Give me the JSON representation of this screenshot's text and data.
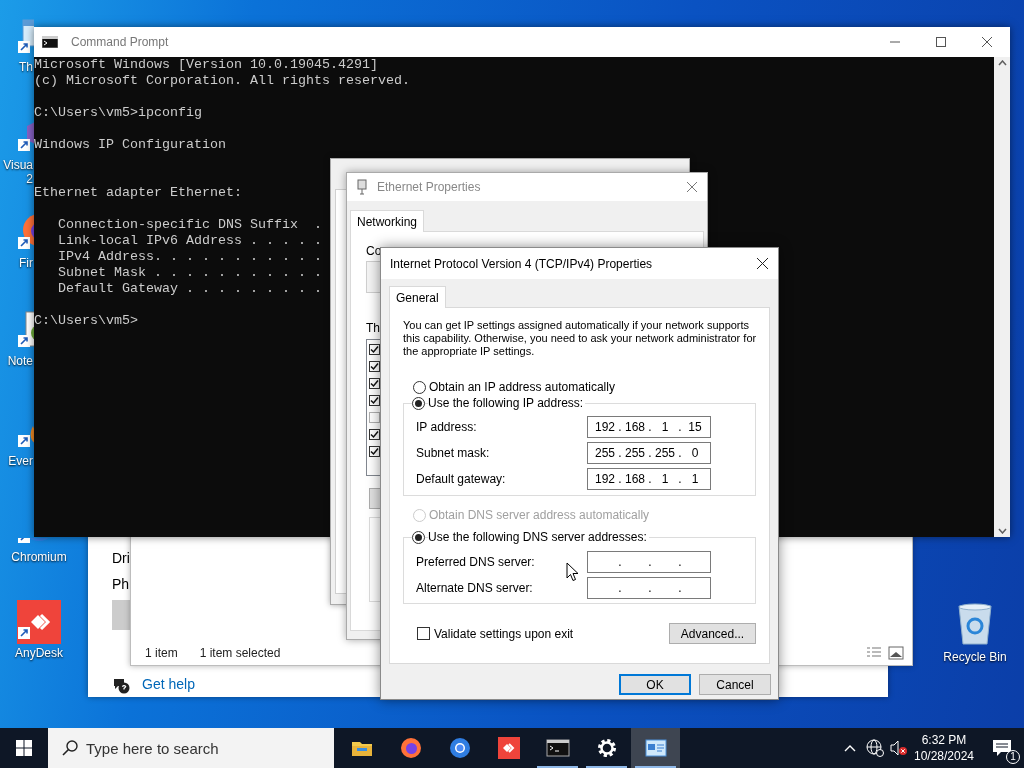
{
  "desktop_icons": [
    {
      "kind": "window",
      "partly_covered": true,
      "label_lines": [
        "Th"
      ]
    },
    {
      "kind": "ide",
      "partly_covered": true,
      "label_lines": [
        "Visua",
        "2"
      ]
    },
    {
      "kind": "firefox",
      "partly_covered": true,
      "label_lines": [
        "Fir"
      ]
    },
    {
      "kind": "notepad",
      "partly_covered": true,
      "label_lines": [
        "Note"
      ]
    },
    {
      "kind": "everything",
      "partly_covered": true,
      "label_lines": [
        "Ever"
      ]
    },
    {
      "kind": "chromium",
      "partly_covered": false,
      "label_lines": [
        "Chromium"
      ]
    },
    {
      "kind": "anydesk",
      "partly_covered": false,
      "label_lines": [
        "AnyDesk"
      ]
    }
  ],
  "recycle_bin": {
    "label": "Recycle Bin"
  },
  "settings_window": {
    "items": [
      "Dri",
      "Ph"
    ],
    "help_link": "Get help"
  },
  "network_connections_window": {
    "status_bar": [
      "1 item",
      "1 item selected"
    ]
  },
  "cmd_window": {
    "title": "Command Prompt",
    "blocks": [
      {
        "kind": "output",
        "lines": [
          "Microsoft Windows [Version 10.0.19045.4291]",
          "(c) Microsoft Corporation. All rights reserved."
        ]
      },
      {
        "kind": "output",
        "lines": [
          "C:\\Users\\vm5>ipconfig"
        ]
      },
      {
        "kind": "header",
        "lines": [
          "Windows IP Configuration"
        ]
      },
      {
        "kind": "output",
        "lines": [
          "Ethernet adapter Ethernet:"
        ]
      },
      {
        "kind": "output",
        "lines": [
          "   Connection-specific DNS Suffix  .",
          "   Link-local IPv6 Address . . . . .",
          "   IPv4 Address. . . . . . . . . . .",
          "   Subnet Mask . . . . . . . . . . .",
          "   Default Gateway . . . . . . . . ."
        ]
      },
      {
        "kind": "output",
        "lines": [
          "C:\\Users\\vm5>"
        ]
      }
    ]
  },
  "ethernet_properties_window": {
    "title": "Ethernet Properties",
    "tabs": [
      {
        "label": "Networking",
        "selected": true
      }
    ],
    "connect_label": "Co",
    "components_label": "Th",
    "components": [
      {
        "checked": true
      },
      {
        "checked": true
      },
      {
        "checked": true
      },
      {
        "checked": true
      },
      {
        "checked": false
      },
      {
        "checked": true
      },
      {
        "checked": true
      }
    ]
  },
  "ipv4_dialog": {
    "title": "Internet Protocol Version 4 (TCP/IPv4) Properties",
    "tabs": [
      {
        "label": "General",
        "selected": true
      }
    ],
    "description": "You can get IP settings assigned automatically if your network supports this capability. Otherwise, you need to ask your network administrator for the appropriate IP settings.",
    "ip_options": [
      {
        "label": "Obtain an IP address automatically",
        "selected": false,
        "disabled": false
      },
      {
        "label": "Use the following IP address:",
        "selected": true,
        "disabled": false
      }
    ],
    "ip_fields": [
      {
        "label": "IP address:",
        "octets": [
          "192",
          "168",
          "1",
          "15"
        ],
        "separator": "."
      },
      {
        "label": "Subnet mask:",
        "octets": [
          "255",
          "255",
          "255",
          "0"
        ],
        "separator": "."
      },
      {
        "label": "Default gateway:",
        "octets": [
          "192",
          "168",
          "1",
          "1"
        ],
        "separator": "."
      }
    ],
    "dns_options": [
      {
        "label": "Obtain DNS server address automatically",
        "selected": false,
        "disabled": true
      },
      {
        "label": "Use the following DNS server addresses:",
        "selected": true,
        "disabled": false
      }
    ],
    "dns_fields": [
      {
        "label": "Preferred DNS server:",
        "separator": "."
      },
      {
        "label": "Alternate DNS server:",
        "separator": "."
      }
    ],
    "validate": {
      "label": "Validate settings upon exit",
      "checked": false
    },
    "advanced_button": "Advanced...",
    "buttons": [
      {
        "label": "OK",
        "default": true
      },
      {
        "label": "Cancel",
        "default": false
      }
    ]
  },
  "taskbar": {
    "search_placeholder": "Type here to search",
    "apps": [
      {
        "kind": "folder",
        "running": false,
        "active": false
      },
      {
        "kind": "firefox",
        "running": false,
        "active": false
      },
      {
        "kind": "chromium",
        "running": false,
        "active": false
      },
      {
        "kind": "anydesk",
        "running": false,
        "active": false
      },
      {
        "kind": "terminal",
        "running": true,
        "active": false
      },
      {
        "kind": "settings",
        "running": true,
        "active": false
      },
      {
        "kind": "network",
        "running": true,
        "active": true
      }
    ],
    "time": "6:32 PM",
    "date": "10/28/2024",
    "notification_count": "1"
  }
}
